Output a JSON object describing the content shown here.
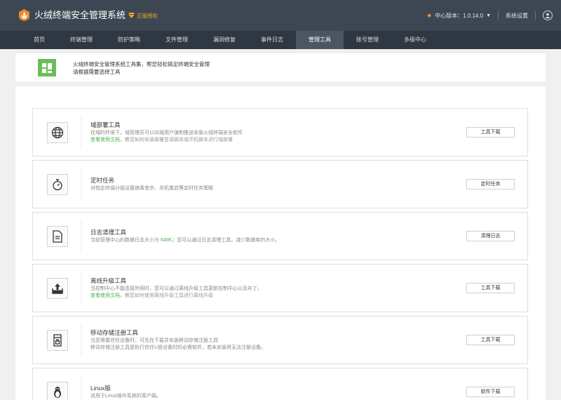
{
  "header": {
    "title": "火绒终端安全管理系统",
    "license": "正版授权",
    "version": "中心版本：1.0.14.0",
    "settings": "系统设置",
    "colors": {
      "bg": "#3d4753",
      "nav_bg": "#2f3842",
      "accent": "#f5a623"
    }
  },
  "nav": {
    "items": [
      {
        "label": "首页"
      },
      {
        "label": "终端管理"
      },
      {
        "label": "防护策略"
      },
      {
        "label": "文件管理"
      },
      {
        "label": "漏洞修复"
      },
      {
        "label": "事件日志"
      },
      {
        "label": "管理工具",
        "active": true
      },
      {
        "label": "账号管理"
      },
      {
        "label": "多级中心"
      }
    ]
  },
  "intro": {
    "line1": "火绒终端安全管理系统工具集，帮您轻松搞定终端安全管理",
    "line2": "请根据需要选择工具"
  },
  "tools": [
    {
      "icon": "globe-icon",
      "title": "域部署工具",
      "desc": "在域的环境下，域管理员可以向域用户强制推送安装火绒终端安全软件",
      "link_text": "查看使用文档",
      "link_suffix": "，教您如何安装部署登录脚本或开机脚本进行域部署",
      "button": "工具下载"
    },
    {
      "icon": "timer-icon",
      "title": "定时任务",
      "desc": "对指定终端分组设置病毒查杀、关机重启等定时任务策略",
      "button": "定时任务"
    },
    {
      "icon": "document-icon",
      "title": "日志清理工具",
      "desc_prefix": "当前管理中心的数据日志大小为",
      "desc_value": "640K",
      "desc_suffix": "；您可以通过日志清理工具，减少数据库的大小。",
      "button": "清理日志"
    },
    {
      "icon": "upload-tray-icon",
      "title": "离线升级工具",
      "desc": "当控制中心不能连接外网时，您可以通过离线升级工具更新控制中心以及补丁。",
      "link_text": "查看使用文档",
      "link_suffix": "，教您如何使用离线升级工具进行离线升级",
      "button": "工具下载"
    },
    {
      "icon": "usb-lock-icon",
      "title": "移动存储注册工具",
      "desc": "当您需要信任设备时，可先在下载并安装移动存储注册工具",
      "desc2": "移动存储注册工具是执行信任U盘设备时的必需软件，若未安装将无法注册设备。",
      "button": "工具下载"
    },
    {
      "icon": "linux-penguin-icon",
      "title": "Linux版",
      "desc": "适用于Linux操作系统的客户端。",
      "button": "软件下载"
    }
  ]
}
